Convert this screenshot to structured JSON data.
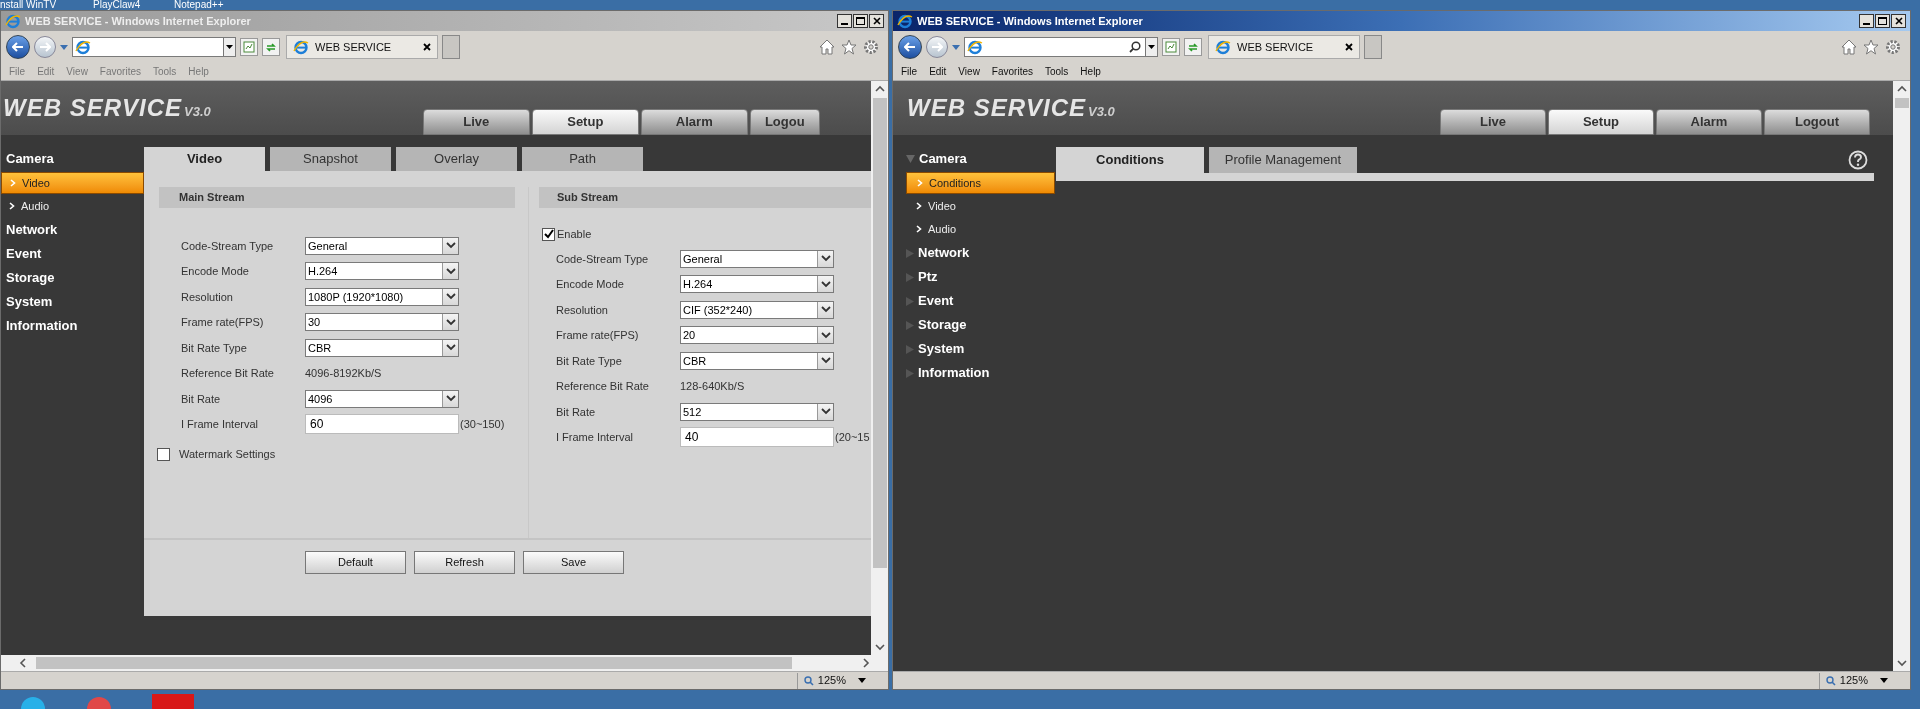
{
  "desktop_shortcuts": [
    "nstall WinTV",
    "PlayClaw4",
    "Notepad++"
  ],
  "left_window": {
    "title": "WEB SERVICE - Windows Internet Explorer",
    "active": false,
    "tab": "WEB SERVICE",
    "menu": [
      "File",
      "Edit",
      "View",
      "Favorites",
      "Tools",
      "Help"
    ],
    "zoom": "125%",
    "app": {
      "logo": "WEB SERVICE",
      "version": "V3.0",
      "nav_tabs": [
        {
          "label": "Live",
          "selected": false
        },
        {
          "label": "Setup",
          "selected": true
        },
        {
          "label": "Alarm",
          "selected": false
        },
        {
          "label": "Logou",
          "selected": false
        }
      ],
      "sidebar": [
        {
          "label": "Camera",
          "selected": false,
          "children": [
            {
              "label": "Video",
              "selected": true
            },
            {
              "label": "Audio",
              "selected": false
            }
          ]
        },
        {
          "label": "Network",
          "selected": false
        },
        {
          "label": "Event",
          "selected": false
        },
        {
          "label": "Storage",
          "selected": false
        },
        {
          "label": "System",
          "selected": false
        },
        {
          "label": "Information",
          "selected": false
        }
      ],
      "page_tabs": [
        {
          "label": "Video",
          "selected": true
        },
        {
          "label": "Snapshot",
          "selected": false
        },
        {
          "label": "Overlay",
          "selected": false
        },
        {
          "label": "Path",
          "selected": false
        }
      ],
      "main_stream": {
        "title": "Main Stream",
        "fields": [
          {
            "label": "Code-Stream Type",
            "kind": "select",
            "value": "General"
          },
          {
            "label": "Encode Mode",
            "kind": "select",
            "value": "H.264"
          },
          {
            "label": "Resolution",
            "kind": "select",
            "value": "1080P (1920*1080)"
          },
          {
            "label": "Frame rate(FPS)",
            "kind": "select",
            "value": "30"
          },
          {
            "label": "Bit Rate Type",
            "kind": "select",
            "value": "CBR"
          },
          {
            "label": "Reference Bit Rate",
            "kind": "text",
            "value": "4096-8192Kb/S"
          },
          {
            "label": "Bit Rate",
            "kind": "select",
            "value": "4096"
          },
          {
            "label": "I Frame Interval",
            "kind": "input",
            "value": "60",
            "hint": "(30~150)"
          }
        ]
      },
      "watermark": {
        "label": "Watermark Settings",
        "checked": false
      },
      "sub_stream": {
        "title": "Sub Stream",
        "enable": {
          "label": "Enable",
          "checked": true
        },
        "fields": [
          {
            "label": "Code-Stream Type",
            "kind": "select",
            "value": "General"
          },
          {
            "label": "Encode Mode",
            "kind": "select",
            "value": "H.264"
          },
          {
            "label": "Resolution",
            "kind": "select",
            "value": "CIF (352*240)"
          },
          {
            "label": "Frame rate(FPS)",
            "kind": "select",
            "value": "20"
          },
          {
            "label": "Bit Rate Type",
            "kind": "select",
            "value": "CBR"
          },
          {
            "label": "Reference Bit Rate",
            "kind": "text",
            "value": "128-640Kb/S"
          },
          {
            "label": "Bit Rate",
            "kind": "select",
            "value": "512"
          },
          {
            "label": "I Frame Interval",
            "kind": "input",
            "value": "40",
            "hint": "(20~15"
          }
        ]
      },
      "buttons": [
        "Default",
        "Refresh",
        "Save"
      ]
    }
  },
  "right_window": {
    "title": "WEB SERVICE - Windows Internet Explorer",
    "active": true,
    "tab": "WEB SERVICE",
    "menu": [
      "File",
      "Edit",
      "View",
      "Favorites",
      "Tools",
      "Help"
    ],
    "zoom": "125%",
    "app": {
      "logo": "WEB SERVICE",
      "version": "V3.0",
      "nav_tabs": [
        {
          "label": "Live",
          "selected": false
        },
        {
          "label": "Setup",
          "selected": true
        },
        {
          "label": "Alarm",
          "selected": false
        },
        {
          "label": "Logout",
          "selected": false
        }
      ],
      "sidebar": [
        {
          "label": "Camera",
          "selected": false,
          "expanded": true,
          "children": [
            {
              "label": "Conditions",
              "selected": true
            },
            {
              "label": "Video",
              "selected": false
            },
            {
              "label": "Audio",
              "selected": false
            }
          ]
        },
        {
          "label": "Network",
          "selected": false,
          "expanded": false
        },
        {
          "label": "Ptz",
          "selected": false,
          "expanded": false
        },
        {
          "label": "Event",
          "selected": false,
          "expanded": false
        },
        {
          "label": "Storage",
          "selected": false,
          "expanded": false
        },
        {
          "label": "System",
          "selected": false,
          "expanded": false
        },
        {
          "label": "Information",
          "selected": false,
          "expanded": false
        }
      ],
      "page_tabs": [
        {
          "label": "Conditions",
          "selected": true
        },
        {
          "label": "Profile Management",
          "selected": false
        }
      ]
    }
  }
}
